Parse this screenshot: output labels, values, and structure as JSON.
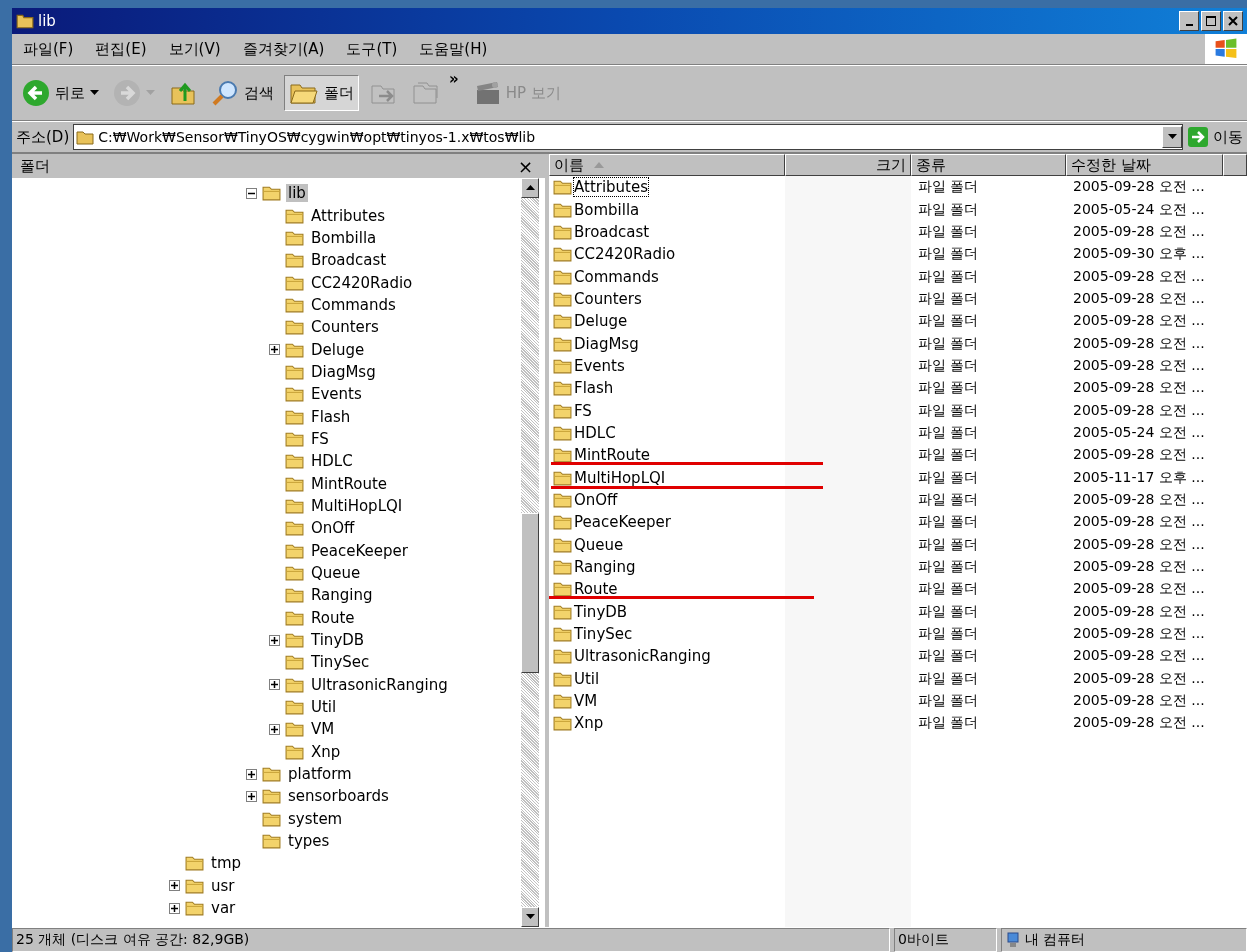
{
  "window": {
    "title": "lib"
  },
  "menu": [
    "파일(F)",
    "편집(E)",
    "보기(V)",
    "즐겨찾기(A)",
    "도구(T)",
    "도움말(H)"
  ],
  "toolbar": [
    {
      "kind": "back",
      "label": "뒤로",
      "disabled": false,
      "pressed": false
    },
    {
      "kind": "forward",
      "disabled": true,
      "pressed": false
    },
    {
      "kind": "up",
      "disabled": false,
      "pressed": false
    },
    {
      "kind": "search",
      "label": "검색",
      "disabled": false,
      "pressed": false
    },
    {
      "kind": "folders",
      "label": "폴더",
      "disabled": false,
      "pressed": true
    },
    {
      "kind": "move",
      "disabled": true,
      "pressed": false
    },
    {
      "kind": "copy",
      "disabled": true,
      "pressed": false
    },
    {
      "kind": "chevron",
      "label": "»"
    },
    {
      "kind": "hp",
      "label": "HP 보기",
      "disabled": true,
      "pressed": false
    }
  ],
  "address": {
    "label": "주소(D)",
    "value": "C:₩Work₩Sensor₩TinyOS₩cygwin₩opt₩tinyos-1.x₩tos₩lib",
    "go": "이동"
  },
  "folder_pane": {
    "title": "폴더",
    "close": "×"
  },
  "tree": {
    "scrolled_group": [
      {
        "label": "lib",
        "expandable": true,
        "expanded": true,
        "selected": true,
        "children": [
          {
            "label": "Attributes",
            "expandable": false,
            "selected": false
          },
          {
            "label": "Bombilla",
            "expandable": false,
            "selected": false
          },
          {
            "label": "Broadcast",
            "expandable": false,
            "selected": false
          },
          {
            "label": "CC2420Radio",
            "expandable": false,
            "selected": false
          },
          {
            "label": "Commands",
            "expandable": false,
            "selected": false
          },
          {
            "label": "Counters",
            "expandable": false,
            "selected": false
          },
          {
            "label": "Deluge",
            "expandable": true,
            "expanded": false,
            "selected": false
          },
          {
            "label": "DiagMsg",
            "expandable": false,
            "selected": false
          },
          {
            "label": "Events",
            "expandable": false,
            "selected": false
          },
          {
            "label": "Flash",
            "expandable": false,
            "selected": false
          },
          {
            "label": "FS",
            "expandable": false,
            "selected": false
          },
          {
            "label": "HDLC",
            "expandable": false,
            "selected": false
          },
          {
            "label": "MintRoute",
            "expandable": false,
            "selected": false
          },
          {
            "label": "MultiHopLQI",
            "expandable": false,
            "selected": false
          },
          {
            "label": "OnOff",
            "expandable": false,
            "selected": false
          },
          {
            "label": "PeaceKeeper",
            "expandable": false,
            "selected": false
          },
          {
            "label": "Queue",
            "expandable": false,
            "selected": false
          },
          {
            "label": "Ranging",
            "expandable": false,
            "selected": false
          },
          {
            "label": "Route",
            "expandable": false,
            "selected": false
          },
          {
            "label": "TinyDB",
            "expandable": true,
            "expanded": false,
            "selected": false
          },
          {
            "label": "TinySec",
            "expandable": false,
            "selected": false
          },
          {
            "label": "UltrasonicRanging",
            "expandable": true,
            "expanded": false,
            "selected": false
          },
          {
            "label": "Util",
            "expandable": false,
            "selected": false
          },
          {
            "label": "VM",
            "expandable": true,
            "expanded": false,
            "selected": false
          },
          {
            "label": "Xnp",
            "expandable": false,
            "selected": false
          }
        ]
      },
      {
        "label": "platform",
        "expandable": true,
        "expanded": false,
        "selected": false
      },
      {
        "label": "sensorboards",
        "expandable": true,
        "expanded": false,
        "selected": false
      },
      {
        "label": "system",
        "expandable": false,
        "selected": false
      },
      {
        "label": "types",
        "expandable": false,
        "selected": false
      }
    ],
    "items": [
      {
        "label": "tmp",
        "expandable": false,
        "selected": false
      },
      {
        "label": "usr",
        "expandable": true,
        "expanded": false,
        "selected": false
      },
      {
        "label": "var",
        "expandable": true,
        "expanded": false,
        "selected": false
      }
    ]
  },
  "list": {
    "columns": [
      {
        "label": "이름",
        "sorted": true
      },
      {
        "label": "크기",
        "sorted": false
      },
      {
        "label": "종류",
        "sorted": false
      },
      {
        "label": "수정한 날짜",
        "sorted": false
      }
    ],
    "rows": [
      {
        "name": "Attributes",
        "type": "파일 폴더",
        "date": "2005-09-28 오전 ...",
        "focused": true
      },
      {
        "name": "Bombilla",
        "type": "파일 폴더",
        "date": "2005-05-24 오전 ...",
        "focused": false
      },
      {
        "name": "Broadcast",
        "type": "파일 폴더",
        "date": "2005-09-28 오전 ...",
        "focused": false
      },
      {
        "name": "CC2420Radio",
        "type": "파일 폴더",
        "date": "2005-09-30 오후 ...",
        "focused": false
      },
      {
        "name": "Commands",
        "type": "파일 폴더",
        "date": "2005-09-28 오전 ...",
        "focused": false
      },
      {
        "name": "Counters",
        "type": "파일 폴더",
        "date": "2005-09-28 오전 ...",
        "focused": false
      },
      {
        "name": "Deluge",
        "type": "파일 폴더",
        "date": "2005-09-28 오전 ...",
        "focused": false
      },
      {
        "name": "DiagMsg",
        "type": "파일 폴더",
        "date": "2005-09-28 오전 ...",
        "focused": false
      },
      {
        "name": "Events",
        "type": "파일 폴더",
        "date": "2005-09-28 오전 ...",
        "focused": false
      },
      {
        "name": "Flash",
        "type": "파일 폴더",
        "date": "2005-09-28 오전 ...",
        "focused": false
      },
      {
        "name": "FS",
        "type": "파일 폴더",
        "date": "2005-09-28 오전 ...",
        "focused": false
      },
      {
        "name": "HDLC",
        "type": "파일 폴더",
        "date": "2005-05-24 오전 ...",
        "focused": false
      },
      {
        "name": "MintRoute",
        "type": "파일 폴더",
        "date": "2005-09-28 오전 ...",
        "focused": false
      },
      {
        "name": "MultiHopLQI",
        "type": "파일 폴더",
        "date": "2005-11-17 오후 ...",
        "focused": false
      },
      {
        "name": "OnOff",
        "type": "파일 폴더",
        "date": "2005-09-28 오전 ...",
        "focused": false
      },
      {
        "name": "PeaceKeeper",
        "type": "파일 폴더",
        "date": "2005-09-28 오전 ...",
        "focused": false
      },
      {
        "name": "Queue",
        "type": "파일 폴더",
        "date": "2005-09-28 오전 ...",
        "focused": false
      },
      {
        "name": "Ranging",
        "type": "파일 폴더",
        "date": "2005-09-28 오전 ...",
        "focused": false
      },
      {
        "name": "Route",
        "type": "파일 폴더",
        "date": "2005-09-28 오전 ...",
        "focused": false
      },
      {
        "name": "TinyDB",
        "type": "파일 폴더",
        "date": "2005-09-28 오전 ...",
        "focused": false
      },
      {
        "name": "TinySec",
        "type": "파일 폴더",
        "date": "2005-09-28 오전 ...",
        "focused": false
      },
      {
        "name": "UltrasonicRanging",
        "type": "파일 폴더",
        "date": "2005-09-28 오전 ...",
        "focused": false
      },
      {
        "name": "Util",
        "type": "파일 폴더",
        "date": "2005-09-28 오전 ...",
        "focused": false
      },
      {
        "name": "VM",
        "type": "파일 폴더",
        "date": "2005-09-28 오전 ...",
        "focused": false
      },
      {
        "name": "Xnp",
        "type": "파일 폴더",
        "date": "2005-09-28 오전 ...",
        "focused": false
      }
    ]
  },
  "status_bar": [
    "25 개체 (디스크 여유 공간: 82,9GB)",
    "0바이트",
    "내 컴퓨터"
  ]
}
